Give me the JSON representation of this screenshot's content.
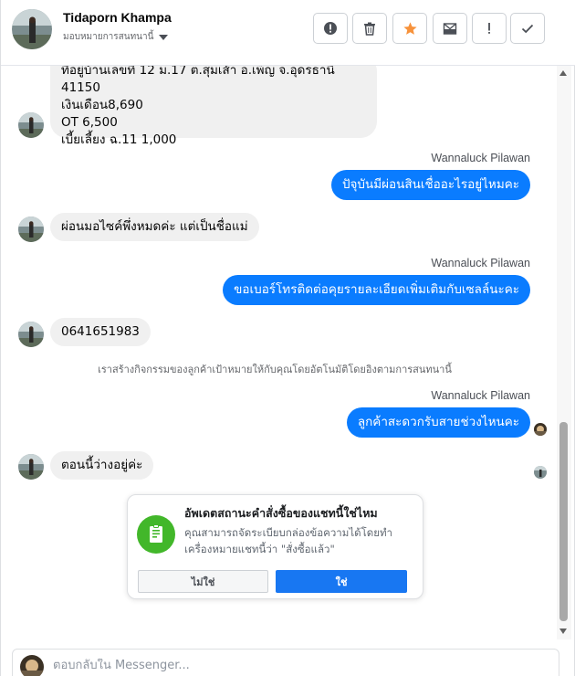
{
  "header": {
    "contact_name": "Tidaporn Khampa",
    "status_label": "มอบหมายการสนทนานี้",
    "actions": [
      {
        "name": "report-button",
        "icon": "alert-circle-icon"
      },
      {
        "name": "delete-button",
        "icon": "trash-icon"
      },
      {
        "name": "star-button",
        "icon": "star-icon"
      },
      {
        "name": "spam-button",
        "icon": "mail-block-icon"
      },
      {
        "name": "mark-important-button",
        "icon": "exclamation-icon"
      },
      {
        "name": "mark-done-button",
        "icon": "check-icon"
      }
    ]
  },
  "messages": {
    "m1_lines": [
      "ที่อยู่บ้านเลขที่ 12 ม.17 ต.สุมเส้า อ.เพ็ญ จ.อุดรธานี 41150",
      "เงินเดือน8,690",
      "OT 6,500",
      "เบี้ยเลี้ยง ฉ.11 1,000"
    ],
    "sender_1": "Wannaluck Pilawan",
    "m2": "ปัจุบันมีผ่อนสินเชื่ออะไรอยู่ไหมคะ",
    "m3": "ผ่อนมอไซค์พึ่งหมดค่ะ แต่เป็นชื่อแม่",
    "sender_2": "Wannaluck Pilawan",
    "m4": "ขอเบอร์โทรติดต่อคุยรายละเอียดเพิ่มเติมกับเซลล์นะคะ",
    "m5": "0641651983",
    "system_note": "เราสร้างกิจกรรมของลูกค้าเป้าหมายให้กับคุณโดยอัตโนมัติโดยอิงตามการสนทนานี้",
    "sender_3": "Wannaluck Pilawan",
    "m6": "ลูกค้าสะดวกรับสายช่วงไหนคะ",
    "m7": "ตอนนี้ว่างอยู่ค่ะ"
  },
  "order_card": {
    "title": "อัพเดตสถานะคำสั่งซื้อของแชทนี้ใช่ไหม",
    "description": "คุณสามารถจัดระเบียบกล่องข้อความได้โดยทำเครื่องหมายแชทนี้ว่า \"สั่งซื้อแล้ว\"",
    "no_label": "ไม่ใช่",
    "yes_label": "ใช่",
    "icon": "order-receipt-icon",
    "accent": "#42b72a"
  },
  "composer": {
    "placeholder": "ตอบกลับใน Messenger..."
  },
  "colors": {
    "outgoing_bubble": "#0a7cff",
    "incoming_bubble": "#f0f0f0",
    "star": "#f7923b",
    "primary_button": "#1877f2"
  }
}
